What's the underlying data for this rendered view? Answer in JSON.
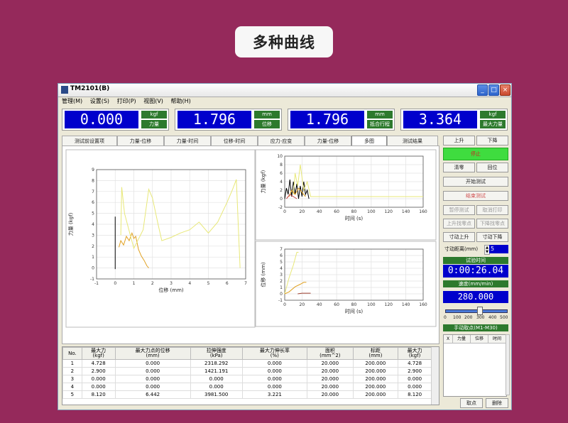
{
  "banner": {
    "title": "多种曲线"
  },
  "window": {
    "title": "TM2101(B)",
    "controls": [
      "_",
      "□",
      "×"
    ]
  },
  "menu": [
    "管理(M)",
    "设置(S)",
    "打印(P)",
    "视图(V)",
    "帮助(H)"
  ],
  "readouts": [
    {
      "value": "0.000",
      "unit": "kgf",
      "label": "力量"
    },
    {
      "value": "1.796",
      "unit": "mm",
      "label": "位移"
    },
    {
      "value": "1.796",
      "unit": "mm",
      "label": "抵合行程"
    },
    {
      "value": "3.364",
      "unit": "kgf",
      "label": "最大力量"
    }
  ],
  "tabs": [
    "测试前设置项",
    "力量-位移",
    "力量-时间",
    "位移-时间",
    "应力-应变",
    "力量-位移",
    "多图",
    "测试结果"
  ],
  "active_tab": "多图",
  "right_panel": {
    "up": "上升",
    "down": "下降",
    "stop": "停止",
    "clear": "清零",
    "return": "回位",
    "start_test": "开始测试",
    "end_test": "结束测试",
    "pause_test": "暂停测试",
    "cancel_print": "取消打印",
    "up_zero": "上升找零点",
    "down_zero": "下降找零点",
    "manual_up": "寸动上升",
    "manual_down": "寸动下降",
    "jog_label": "寸动距离(mm)",
    "jog_value": "5",
    "test_time_label": "试验时间",
    "test_time": "0:00:26.04",
    "speed_label": "速度(mm/min)",
    "speed_value": "280.000",
    "slider_ticks": [
      "0",
      "100",
      "200",
      "300",
      "400",
      "500"
    ],
    "slider_value": 280,
    "manual_pick_label": "手动取点(M1-M30)",
    "pick_cols": [
      "X",
      "力量",
      "位移",
      "时间"
    ],
    "pick_btn": "取点",
    "delete_btn": "删除"
  },
  "results": {
    "headers": [
      [
        "No.",
        ""
      ],
      [
        "最大力",
        "(kgf)"
      ],
      [
        "最大力点的位移",
        "(mm)"
      ],
      [
        "拉伸强度",
        "(kPa)"
      ],
      [
        "最大力伸长率",
        "(%)"
      ],
      [
        "面积",
        "(mm^2)"
      ],
      [
        "标距",
        "(mm)"
      ],
      [
        "最大力",
        "(kgf)"
      ]
    ],
    "rows": [
      [
        "1",
        "4.728",
        "0.000",
        "2318.292",
        "0.000",
        "20.000",
        "200.000",
        "4.728"
      ],
      [
        "2",
        "2.900",
        "0.000",
        "1421.191",
        "0.000",
        "20.000",
        "200.000",
        "2.900"
      ],
      [
        "3",
        "0.000",
        "0.000",
        "0.000",
        "0.000",
        "20.000",
        "200.000",
        "0.000"
      ],
      [
        "4",
        "0.000",
        "0.000",
        "0.000",
        "0.000",
        "20.000",
        "200.000",
        "0.000"
      ],
      [
        "5",
        "8.120",
        "6.442",
        "3981.500",
        "3.221",
        "20.000",
        "200.000",
        "8.120"
      ]
    ]
  },
  "chart_data": [
    {
      "type": "line",
      "title": "",
      "xlabel": "位移 (mm)",
      "ylabel": "力量 (kgf)",
      "xlim": [
        -1,
        7
      ],
      "ylim": [
        -1,
        9
      ],
      "xticks": [
        "-1",
        "0",
        "1",
        "2",
        "3",
        "4",
        "5",
        "6",
        "7"
      ],
      "yticks": [
        "-1",
        "0",
        "1",
        "2",
        "3",
        "4",
        "5",
        "6",
        "7",
        "8",
        "9"
      ],
      "series": [
        {
          "color": "#000000",
          "x": [
            0,
            0
          ],
          "y": [
            -0.1,
            4.7
          ]
        },
        {
          "color": "#e0a020",
          "x": [
            0.2,
            0.3,
            0.45,
            0.6,
            0.75,
            0.9,
            1.0,
            1.1,
            1.25,
            1.4,
            1.55,
            1.7,
            1.8
          ],
          "y": [
            1.9,
            2.5,
            2.1,
            2.9,
            2.5,
            3.2,
            2.7,
            2.9,
            1.7,
            1.1,
            0.7,
            0.2,
            0.0
          ]
        },
        {
          "color": "#e8e878",
          "x": [
            0.3,
            0.35,
            0.5,
            1.0,
            1.5,
            1.8,
            2.0,
            2.3,
            2.5,
            3.0,
            3.5,
            4.0,
            4.5,
            5.0,
            5.5,
            6.0,
            6.3,
            6.5,
            6.7
          ],
          "y": [
            3.0,
            7.4,
            5.0,
            1.8,
            3.5,
            7.2,
            6.4,
            4.0,
            2.5,
            2.8,
            3.2,
            3.5,
            4.2,
            3.2,
            4.2,
            6.0,
            7.2,
            8.1,
            0.0
          ]
        }
      ]
    },
    {
      "type": "line",
      "title": "",
      "xlabel": "时间 (s)",
      "ylabel": "力量 (kgf)",
      "xlim": [
        0,
        160
      ],
      "ylim": [
        -2,
        10
      ],
      "xticks": [
        "0",
        "20",
        "40",
        "60",
        "80",
        "100",
        "120",
        "140",
        "160"
      ],
      "yticks": [
        "-2",
        "0",
        "2",
        "4",
        "6",
        "8",
        "10"
      ],
      "series": [
        {
          "color": "#000000",
          "x": [
            0,
            2,
            4,
            6,
            8,
            10,
            12,
            14,
            16,
            18,
            20,
            22,
            24,
            26,
            28
          ],
          "y": [
            0,
            2.5,
            1,
            4.5,
            0.5,
            4,
            1,
            3.5,
            0,
            3,
            0.5,
            4,
            1,
            2,
            0
          ]
        },
        {
          "color": "#e8e878",
          "x": [
            10,
            12,
            15,
            18,
            22,
            26,
            30,
            160
          ],
          "y": [
            1,
            6,
            3,
            8,
            2,
            4,
            0.5,
            0.5
          ]
        },
        {
          "color": "#e0a020",
          "x": [
            5,
            8,
            12,
            16,
            20,
            24
          ],
          "y": [
            0.5,
            2,
            1,
            2.5,
            1.5,
            0.5
          ]
        },
        {
          "color": "#c04040",
          "x": [
            2,
            6,
            10,
            14
          ],
          "y": [
            0,
            1,
            0.5,
            0
          ]
        }
      ]
    },
    {
      "type": "line",
      "title": "",
      "xlabel": "时间 (s)",
      "ylabel": "位移 (mm)",
      "xlim": [
        0,
        160
      ],
      "ylim": [
        -1,
        7
      ],
      "xticks": [
        "0",
        "20",
        "40",
        "60",
        "80",
        "100",
        "120",
        "140",
        "160"
      ],
      "yticks": [
        "-1",
        "0",
        "1",
        "2",
        "3",
        "4",
        "5",
        "6",
        "7"
      ],
      "series": [
        {
          "color": "#e8e878",
          "x": [
            0,
            5,
            10,
            14,
            16
          ],
          "y": [
            0,
            2.5,
            4.5,
            6.5,
            6.5
          ]
        },
        {
          "color": "#e0a020",
          "x": [
            0,
            5,
            12,
            18,
            22,
            25
          ],
          "y": [
            0,
            0.3,
            1.1,
            1.5,
            1.8,
            1.8
          ]
        },
        {
          "color": "#a04030",
          "x": [
            15,
            20,
            25,
            30
          ],
          "y": [
            0,
            0.1,
            0.1,
            0.1
          ]
        }
      ]
    }
  ]
}
